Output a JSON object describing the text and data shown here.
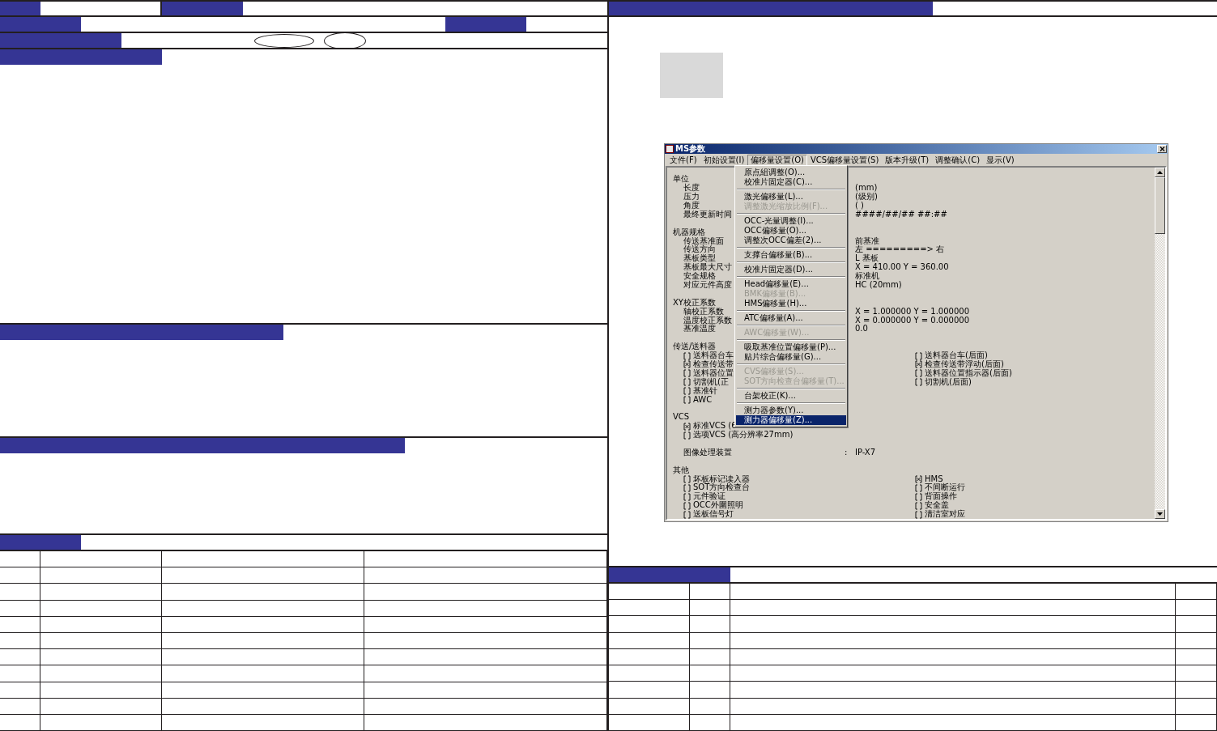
{
  "app_window": {
    "title": "MS参数",
    "menu_bar": [
      {
        "label": "文件(F)",
        "selected": false
      },
      {
        "label": "初始设置(I)",
        "selected": false
      },
      {
        "label": "偏移量设置(O)",
        "selected": true
      },
      {
        "label": "VCS偏移量设置(S)",
        "selected": false
      },
      {
        "label": "版本升级(T)",
        "selected": false
      },
      {
        "label": "调整确认(C)",
        "selected": false
      },
      {
        "label": "显示(V)",
        "selected": false
      }
    ],
    "dropdown": [
      {
        "kind": "item",
        "label": "原点組调整(O)...",
        "disabled": false,
        "selected": false
      },
      {
        "kind": "item",
        "label": "校准片固定器(C)...",
        "disabled": false,
        "selected": false
      },
      {
        "kind": "separator"
      },
      {
        "kind": "item",
        "label": "激光偏移量(L)...",
        "disabled": false,
        "selected": false
      },
      {
        "kind": "item",
        "label": "调整激光缩放比例(F)...",
        "disabled": true,
        "selected": false
      },
      {
        "kind": "separator"
      },
      {
        "kind": "item",
        "label": "OCC-光量调整(I)...",
        "disabled": false,
        "selected": false
      },
      {
        "kind": "item",
        "label": "OCC偏移量(O)...",
        "disabled": false,
        "selected": false
      },
      {
        "kind": "item",
        "label": "调整次OCC偏差(2)...",
        "disabled": false,
        "selected": false
      },
      {
        "kind": "separator"
      },
      {
        "kind": "item",
        "label": "支撑台偏移量(B)...",
        "disabled": false,
        "selected": false
      },
      {
        "kind": "separator"
      },
      {
        "kind": "item",
        "label": "校准片固定器(D)...",
        "disabled": false,
        "selected": false
      },
      {
        "kind": "separator"
      },
      {
        "kind": "item",
        "label": "Head偏移量(E)...",
        "disabled": false,
        "selected": false
      },
      {
        "kind": "item",
        "label": "BMK偏移量(B)...",
        "disabled": true,
        "selected": false
      },
      {
        "kind": "item",
        "label": "HMS偏移量(H)...",
        "disabled": false,
        "selected": false
      },
      {
        "kind": "separator"
      },
      {
        "kind": "item",
        "label": "ATC偏移量(A)...",
        "disabled": false,
        "selected": false
      },
      {
        "kind": "separator"
      },
      {
        "kind": "item",
        "label": "AWC偏移量(W)...",
        "disabled": true,
        "selected": false
      },
      {
        "kind": "separator"
      },
      {
        "kind": "item",
        "label": "吸取基准位置偏移量(P)...",
        "disabled": false,
        "selected": false
      },
      {
        "kind": "item",
        "label": "贴片综合偏移量(G)...",
        "disabled": false,
        "selected": false
      },
      {
        "kind": "separator"
      },
      {
        "kind": "item",
        "label": "CVS偏移量(S)...",
        "disabled": true,
        "selected": false
      },
      {
        "kind": "item",
        "label": "SOT方向检查台偏移量(T)...",
        "disabled": true,
        "selected": false
      },
      {
        "kind": "separator"
      },
      {
        "kind": "item",
        "label": "台架校正(K)...",
        "disabled": false,
        "selected": false
      },
      {
        "kind": "separator"
      },
      {
        "kind": "item",
        "label": "测力器参数(Y)...",
        "disabled": false,
        "selected": false
      },
      {
        "kind": "item",
        "label": "测力器偏移量(Z)...",
        "disabled": false,
        "selected": true
      }
    ],
    "sections": [
      {
        "title": "单位",
        "rows": [
          {
            "kind": "value",
            "label": "长度",
            "value": "(mm)"
          },
          {
            "kind": "value",
            "label": "压力",
            "value": "(级别)"
          },
          {
            "kind": "value",
            "label": "角度",
            "value": "( )"
          },
          {
            "kind": "value",
            "label": "最终更新时间",
            "value": "####/##/## ##:##"
          }
        ]
      },
      {
        "title": "机器规格",
        "rows": [
          {
            "kind": "value",
            "label": "传送基准面",
            "value": "前基准"
          },
          {
            "kind": "value",
            "label": "传送方向",
            "value": "左 =========> 右"
          },
          {
            "kind": "value",
            "label": "基板类型",
            "value": "L 基板"
          },
          {
            "kind": "value",
            "label": "基板最大尺寸",
            "value": "X =  410.00  Y =  360.00"
          },
          {
            "kind": "value",
            "label": "安全规格",
            "value": "标准机"
          },
          {
            "kind": "value",
            "label": "对应元件高度",
            "value": "HC (20mm)"
          }
        ]
      },
      {
        "title": "XY校正系数",
        "rows": [
          {
            "kind": "value",
            "label": "轴校正系数",
            "value": "X = 1.000000  Y = 1.000000"
          },
          {
            "kind": "value",
            "label": "温度校正系数",
            "value": "X = 0.000000  Y = 0.000000"
          },
          {
            "kind": "value",
            "label": "基准温度",
            "value": " 0.0"
          }
        ]
      },
      {
        "title": "传送/送料器",
        "rows": [
          {
            "kind": "check",
            "checked": false,
            "label": "送料器台车",
            "right": {
              "checked": false,
              "label": "送料器台车(后面)"
            }
          },
          {
            "kind": "check",
            "checked": true,
            "label": "检查传送带",
            "right": {
              "checked": true,
              "label": "检查传送带浮动(后面)"
            }
          },
          {
            "kind": "check",
            "checked": false,
            "label": "送料器位置",
            "right": {
              "checked": false,
              "label": "送料器位置指示器(后面)"
            }
          },
          {
            "kind": "check",
            "checked": false,
            "label": "切割机(正",
            "right": {
              "checked": false,
              "label": "切割机(后面)"
            }
          },
          {
            "kind": "check",
            "checked": false,
            "label": "基准针"
          },
          {
            "kind": "check",
            "checked": false,
            "label": "AWC"
          }
        ]
      },
      {
        "title": "VCS",
        "rows": [
          {
            "kind": "check",
            "checked": true,
            "label": "标准VCS (6"
          },
          {
            "kind": "check",
            "checked": false,
            "label": "选项VCS (高分辨率27mm)"
          }
        ]
      },
      {
        "rows": [
          {
            "kind": "value",
            "label": "图像处理装置",
            "separator": ":",
            "value": "IP-X7"
          }
        ]
      },
      {
        "title": "其他",
        "rows": [
          {
            "kind": "check",
            "checked": false,
            "label": "坏板标记读入器",
            "right": {
              "checked": true,
              "label": "HMS"
            }
          },
          {
            "kind": "check",
            "checked": false,
            "label": "SOT方向检查台",
            "right": {
              "checked": false,
              "label": "不间断运行"
            }
          },
          {
            "kind": "check",
            "checked": false,
            "label": "元件验证",
            "right": {
              "checked": false,
              "label": "背面操作"
            }
          },
          {
            "kind": "check",
            "checked": false,
            "label": "OCC外圍照明",
            "right": {
              "checked": false,
              "label": "安全盖"
            }
          },
          {
            "kind": "check",
            "checked": false,
            "label": "送板信号灯",
            "right": {
              "checked": false,
              "label": "清洁室对应"
            }
          }
        ]
      }
    ]
  }
}
